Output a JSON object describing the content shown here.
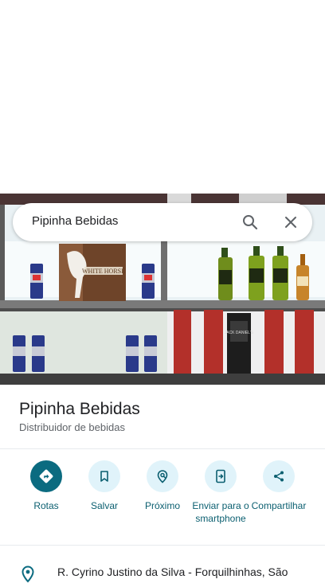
{
  "search": {
    "query": "Pipinha Bebidas",
    "search_icon": "search-icon",
    "close_icon": "close-icon"
  },
  "photo": {
    "box_brand_text": "WHITE HORSE",
    "bottle_label_text": "JACK DANIEL'S"
  },
  "place": {
    "name": "Pipinha Bebidas",
    "category": "Distribuidor de bebidas"
  },
  "actions": [
    {
      "label": "Rotas",
      "icon": "directions-icon",
      "primary": true
    },
    {
      "label": "Salvar",
      "icon": "bookmark-icon",
      "primary": false
    },
    {
      "label": "Próximo",
      "icon": "nearby-icon",
      "primary": false
    },
    {
      "label": "Enviar para o smartphone",
      "icon": "send-to-phone-icon",
      "primary": false
    },
    {
      "label": "Compartilhar",
      "icon": "share-icon",
      "primary": false
    }
  ],
  "address": {
    "icon": "location-pin-icon",
    "text": "R. Cyrino Justino da Silva - Forquilhinhas, São"
  },
  "colors": {
    "accent": "#0b6b80",
    "action_bg": "#e0f3fa",
    "action_text": "#0b5f70"
  }
}
